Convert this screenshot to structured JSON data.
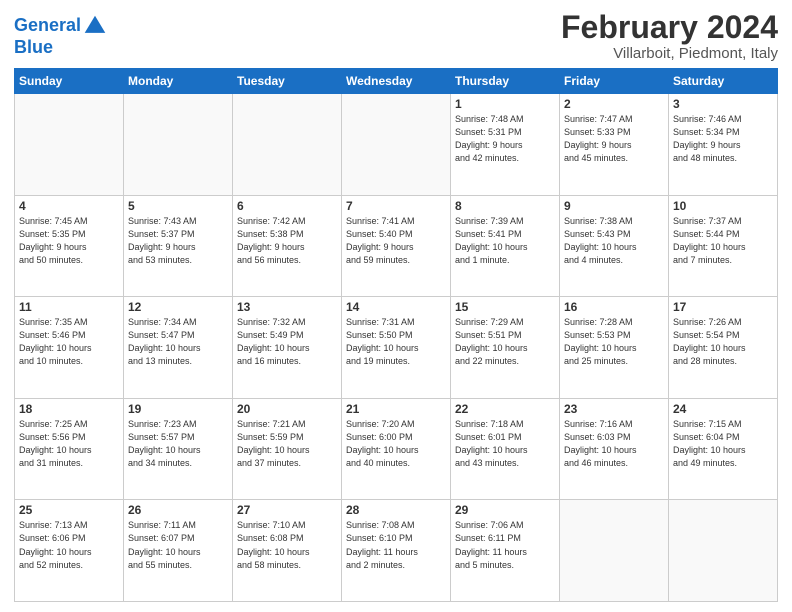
{
  "header": {
    "logo_line1": "General",
    "logo_line2": "Blue",
    "title": "February 2024",
    "subtitle": "Villarboit, Piedmont, Italy"
  },
  "weekdays": [
    "Sunday",
    "Monday",
    "Tuesday",
    "Wednesday",
    "Thursday",
    "Friday",
    "Saturday"
  ],
  "weeks": [
    [
      {
        "day": "",
        "info": ""
      },
      {
        "day": "",
        "info": ""
      },
      {
        "day": "",
        "info": ""
      },
      {
        "day": "",
        "info": ""
      },
      {
        "day": "1",
        "info": "Sunrise: 7:48 AM\nSunset: 5:31 PM\nDaylight: 9 hours\nand 42 minutes."
      },
      {
        "day": "2",
        "info": "Sunrise: 7:47 AM\nSunset: 5:33 PM\nDaylight: 9 hours\nand 45 minutes."
      },
      {
        "day": "3",
        "info": "Sunrise: 7:46 AM\nSunset: 5:34 PM\nDaylight: 9 hours\nand 48 minutes."
      }
    ],
    [
      {
        "day": "4",
        "info": "Sunrise: 7:45 AM\nSunset: 5:35 PM\nDaylight: 9 hours\nand 50 minutes."
      },
      {
        "day": "5",
        "info": "Sunrise: 7:43 AM\nSunset: 5:37 PM\nDaylight: 9 hours\nand 53 minutes."
      },
      {
        "day": "6",
        "info": "Sunrise: 7:42 AM\nSunset: 5:38 PM\nDaylight: 9 hours\nand 56 minutes."
      },
      {
        "day": "7",
        "info": "Sunrise: 7:41 AM\nSunset: 5:40 PM\nDaylight: 9 hours\nand 59 minutes."
      },
      {
        "day": "8",
        "info": "Sunrise: 7:39 AM\nSunset: 5:41 PM\nDaylight: 10 hours\nand 1 minute."
      },
      {
        "day": "9",
        "info": "Sunrise: 7:38 AM\nSunset: 5:43 PM\nDaylight: 10 hours\nand 4 minutes."
      },
      {
        "day": "10",
        "info": "Sunrise: 7:37 AM\nSunset: 5:44 PM\nDaylight: 10 hours\nand 7 minutes."
      }
    ],
    [
      {
        "day": "11",
        "info": "Sunrise: 7:35 AM\nSunset: 5:46 PM\nDaylight: 10 hours\nand 10 minutes."
      },
      {
        "day": "12",
        "info": "Sunrise: 7:34 AM\nSunset: 5:47 PM\nDaylight: 10 hours\nand 13 minutes."
      },
      {
        "day": "13",
        "info": "Sunrise: 7:32 AM\nSunset: 5:49 PM\nDaylight: 10 hours\nand 16 minutes."
      },
      {
        "day": "14",
        "info": "Sunrise: 7:31 AM\nSunset: 5:50 PM\nDaylight: 10 hours\nand 19 minutes."
      },
      {
        "day": "15",
        "info": "Sunrise: 7:29 AM\nSunset: 5:51 PM\nDaylight: 10 hours\nand 22 minutes."
      },
      {
        "day": "16",
        "info": "Sunrise: 7:28 AM\nSunset: 5:53 PM\nDaylight: 10 hours\nand 25 minutes."
      },
      {
        "day": "17",
        "info": "Sunrise: 7:26 AM\nSunset: 5:54 PM\nDaylight: 10 hours\nand 28 minutes."
      }
    ],
    [
      {
        "day": "18",
        "info": "Sunrise: 7:25 AM\nSunset: 5:56 PM\nDaylight: 10 hours\nand 31 minutes."
      },
      {
        "day": "19",
        "info": "Sunrise: 7:23 AM\nSunset: 5:57 PM\nDaylight: 10 hours\nand 34 minutes."
      },
      {
        "day": "20",
        "info": "Sunrise: 7:21 AM\nSunset: 5:59 PM\nDaylight: 10 hours\nand 37 minutes."
      },
      {
        "day": "21",
        "info": "Sunrise: 7:20 AM\nSunset: 6:00 PM\nDaylight: 10 hours\nand 40 minutes."
      },
      {
        "day": "22",
        "info": "Sunrise: 7:18 AM\nSunset: 6:01 PM\nDaylight: 10 hours\nand 43 minutes."
      },
      {
        "day": "23",
        "info": "Sunrise: 7:16 AM\nSunset: 6:03 PM\nDaylight: 10 hours\nand 46 minutes."
      },
      {
        "day": "24",
        "info": "Sunrise: 7:15 AM\nSunset: 6:04 PM\nDaylight: 10 hours\nand 49 minutes."
      }
    ],
    [
      {
        "day": "25",
        "info": "Sunrise: 7:13 AM\nSunset: 6:06 PM\nDaylight: 10 hours\nand 52 minutes."
      },
      {
        "day": "26",
        "info": "Sunrise: 7:11 AM\nSunset: 6:07 PM\nDaylight: 10 hours\nand 55 minutes."
      },
      {
        "day": "27",
        "info": "Sunrise: 7:10 AM\nSunset: 6:08 PM\nDaylight: 10 hours\nand 58 minutes."
      },
      {
        "day": "28",
        "info": "Sunrise: 7:08 AM\nSunset: 6:10 PM\nDaylight: 11 hours\nand 2 minutes."
      },
      {
        "day": "29",
        "info": "Sunrise: 7:06 AM\nSunset: 6:11 PM\nDaylight: 11 hours\nand 5 minutes."
      },
      {
        "day": "",
        "info": ""
      },
      {
        "day": "",
        "info": ""
      }
    ]
  ]
}
